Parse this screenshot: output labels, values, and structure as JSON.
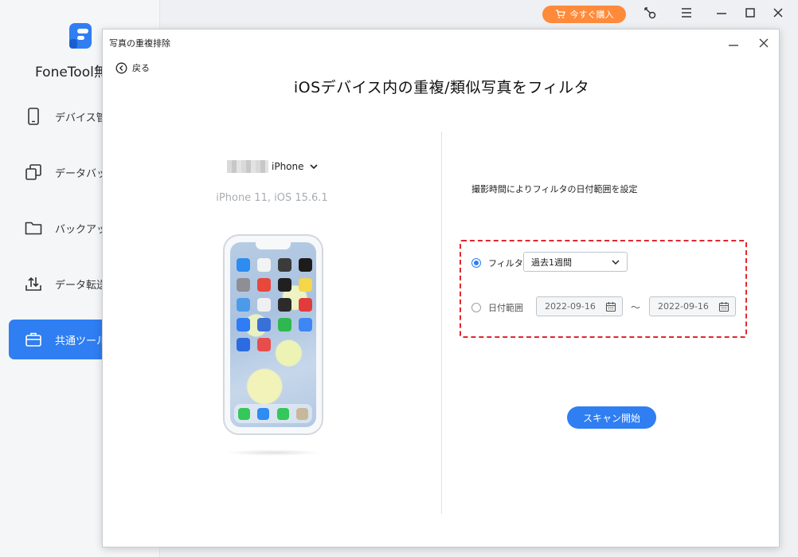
{
  "app": {
    "title": "FoneTool無",
    "buy_label": "今すぐ購入",
    "nav": [
      {
        "label": "デバイス管",
        "icon": "phone-icon"
      },
      {
        "label": "データバッ",
        "icon": "copy-icon"
      },
      {
        "label": "バックアッ",
        "icon": "folder-icon"
      },
      {
        "label": "データ転送",
        "icon": "upload-icon"
      },
      {
        "label": "共通ツール",
        "icon": "toolbox-icon",
        "active": true
      }
    ]
  },
  "dialog": {
    "title": "写真の重複排除",
    "back_label": "戻る",
    "heading": "iOSデバイス内の重複/類似写真をフィルタ",
    "device": {
      "name": "iPhone",
      "model": "iPhone 11, iOS 15.6.1"
    },
    "filter": {
      "description": "撮影時間によりフィルタの日付範囲を設定",
      "option_filter_label": "フィルタ",
      "option_filter_selected": true,
      "period_value": "過去1週間",
      "option_range_label": "日付範囲",
      "date_from": "2022-09-16",
      "separator": "～",
      "date_to": "2022-09-16"
    },
    "scan_label": "スキャン開始"
  },
  "colors": {
    "accent": "#2f7ef2",
    "buy": "#ff8a3a",
    "highlight": "#e0282e"
  }
}
